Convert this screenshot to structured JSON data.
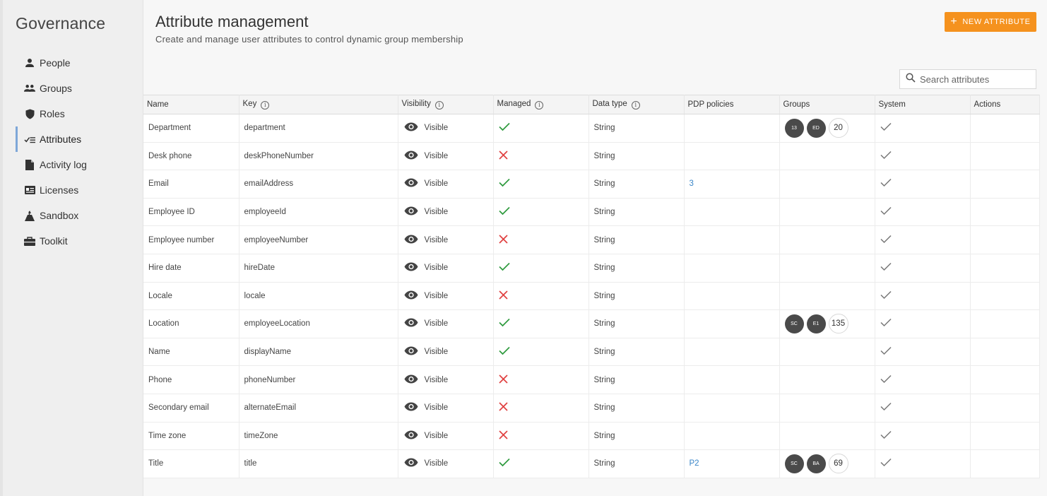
{
  "sidebar": {
    "brand": "Governance",
    "items": [
      {
        "label": "People",
        "icon": "person-icon"
      },
      {
        "label": "Groups",
        "icon": "groups-icon"
      },
      {
        "label": "Roles",
        "icon": "shield-icon"
      },
      {
        "label": "Attributes",
        "icon": "attributes-icon",
        "active": true
      },
      {
        "label": "Activity log",
        "icon": "document-icon"
      },
      {
        "label": "Licenses",
        "icon": "license-card-icon"
      },
      {
        "label": "Sandbox",
        "icon": "sandbox-icon"
      },
      {
        "label": "Toolkit",
        "icon": "toolbox-icon"
      }
    ]
  },
  "header": {
    "title": "Attribute management",
    "subtitle": "Create and manage user attributes to control dynamic group membership",
    "new_button": "NEW ATTRIBUTE"
  },
  "search": {
    "placeholder": "Search attributes"
  },
  "colors": {
    "accent": "#f5921e",
    "check": "#2e9a3e",
    "cross": "#e04040",
    "link": "#3a86c8"
  },
  "table": {
    "columns": [
      "Name",
      "Key",
      "Visibility",
      "Managed",
      "Data type",
      "PDP policies",
      "Groups",
      "System",
      "Actions"
    ],
    "rows": [
      {
        "name": "Department",
        "key": "department",
        "visibility": "Visible",
        "managed": true,
        "type": "String",
        "pdp": "",
        "groups": [
          "13",
          "ED"
        ],
        "group_count": "20",
        "system": true
      },
      {
        "name": "Desk phone",
        "key": "deskPhoneNumber",
        "visibility": "Visible",
        "managed": false,
        "type": "String",
        "pdp": "",
        "groups": [],
        "group_count": "",
        "system": true
      },
      {
        "name": "Email",
        "key": "emailAddress",
        "visibility": "Visible",
        "managed": true,
        "type": "String",
        "pdp": "3",
        "groups": [],
        "group_count": "",
        "system": true
      },
      {
        "name": "Employee ID",
        "key": "employeeId",
        "visibility": "Visible",
        "managed": true,
        "type": "String",
        "pdp": "",
        "groups": [],
        "group_count": "",
        "system": true
      },
      {
        "name": "Employee number",
        "key": "employeeNumber",
        "visibility": "Visible",
        "managed": false,
        "type": "String",
        "pdp": "",
        "groups": [],
        "group_count": "",
        "system": true
      },
      {
        "name": "Hire date",
        "key": "hireDate",
        "visibility": "Visible",
        "managed": true,
        "type": "String",
        "pdp": "",
        "groups": [],
        "group_count": "",
        "system": true
      },
      {
        "name": "Locale",
        "key": "locale",
        "visibility": "Visible",
        "managed": false,
        "type": "String",
        "pdp": "",
        "groups": [],
        "group_count": "",
        "system": true
      },
      {
        "name": "Location",
        "key": "employeeLocation",
        "visibility": "Visible",
        "managed": true,
        "type": "String",
        "pdp": "",
        "groups": [
          "SC",
          "E1"
        ],
        "group_count": "135",
        "system": true
      },
      {
        "name": "Name",
        "key": "displayName",
        "visibility": "Visible",
        "managed": true,
        "type": "String",
        "pdp": "",
        "groups": [],
        "group_count": "",
        "system": true
      },
      {
        "name": "Phone",
        "key": "phoneNumber",
        "visibility": "Visible",
        "managed": false,
        "type": "String",
        "pdp": "",
        "groups": [],
        "group_count": "",
        "system": true
      },
      {
        "name": "Secondary email",
        "key": "alternateEmail",
        "visibility": "Visible",
        "managed": false,
        "type": "String",
        "pdp": "",
        "groups": [],
        "group_count": "",
        "system": true
      },
      {
        "name": "Time zone",
        "key": "timeZone",
        "visibility": "Visible",
        "managed": false,
        "type": "String",
        "pdp": "",
        "groups": [],
        "group_count": "",
        "system": true
      },
      {
        "name": "Title",
        "key": "title",
        "visibility": "Visible",
        "managed": true,
        "type": "String",
        "pdp": "P2",
        "groups": [
          "SC",
          "BA"
        ],
        "group_count": "69",
        "system": true
      }
    ]
  }
}
